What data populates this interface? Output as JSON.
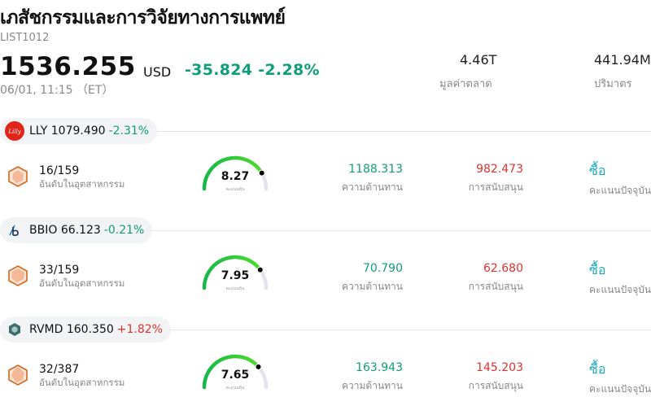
{
  "header": {
    "title": "เภสัชกรรมและการวิจัยทางการแพทย์",
    "ticker": "LIST1012",
    "price": "1536.255",
    "currency": "USD",
    "change": "-35.824 -2.28%",
    "time": "06/01, 11:15 （ET）",
    "market_cap_value": "4.46T",
    "market_cap_label": "มูลค่าตลาด",
    "volume_value": "441.94M",
    "volume_label": "ปริมาตร"
  },
  "stocks": [
    {
      "symbol": "LLY",
      "price": "1079.490",
      "change": "-2.31%",
      "change_color": "#0f9d7a",
      "logo_icon": "lilly-logo-icon",
      "rank": "16/159",
      "rank_label": "อันดับในอุตสาหกรรม",
      "score": "8.27",
      "score_fraction": 0.83,
      "score_sub": "คะแนนหุ้น",
      "resistance": "1188.313",
      "resistance_label": "ความต้านทาน",
      "support": "982.473",
      "support_label": "การสนับสนุน",
      "action": "ซื้อ",
      "action_label": "คะแนนปัจจุบัน"
    },
    {
      "symbol": "BBIO",
      "price": "66.123",
      "change": "-0.21%",
      "change_color": "#0f9d7a",
      "logo_icon": "bridgebio-logo-icon",
      "rank": "33/159",
      "rank_label": "อันดับในอุตสาหกรรม",
      "score": "7.95",
      "score_fraction": 0.8,
      "score_sub": "คะแนนหุ้น",
      "resistance": "70.790",
      "resistance_label": "ความต้านทาน",
      "support": "62.680",
      "support_label": "การสนับสนุน",
      "action": "ซื้อ",
      "action_label": "คะแนนปัจจุบัน"
    },
    {
      "symbol": "RVMD",
      "price": "160.350",
      "change": "+1.82%",
      "change_color": "#e0322f",
      "logo_icon": "revolution-medicines-logo-icon",
      "rank": "32/387",
      "rank_label": "อันดับในอุตสาหกรรม",
      "score": "7.65",
      "score_fraction": 0.77,
      "score_sub": "คะแนนหุ้น",
      "resistance": "163.943",
      "resistance_label": "ความต้านทาน",
      "support": "145.203",
      "support_label": "การสนับสนุน",
      "action": "ซื้อ",
      "action_label": "คะแนนปัจจุบัน"
    }
  ]
}
